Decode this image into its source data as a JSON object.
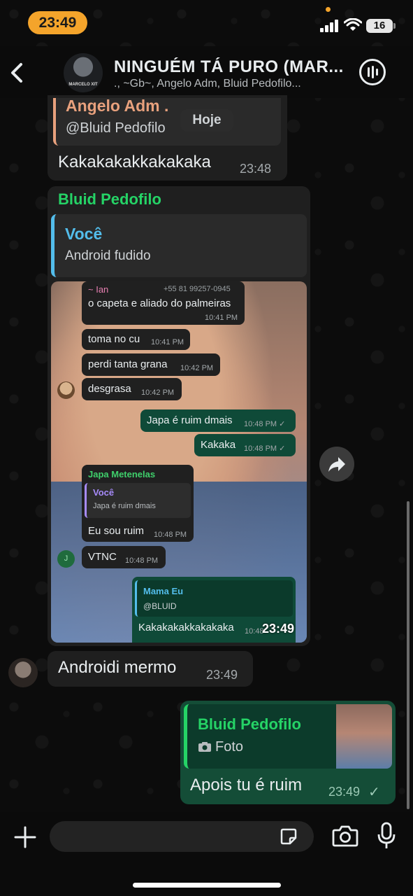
{
  "status_bar": {
    "time": "23:49",
    "battery": "16"
  },
  "header": {
    "title": "NINGUÉM TÁ PURO (MAR...",
    "subtitle": "., ~Gb~, Angelo Adm, Bluid Pedofilo...",
    "avatar_text": "MARCELO XIT"
  },
  "messages": {
    "top_quote": {
      "sender": "Angelo Adm .",
      "text": "@Bluid Pedofilo",
      "date_chip": "Hoje"
    },
    "msg1": {
      "text": "Kakakakakkakakaka",
      "time": "23:48"
    },
    "msg2": {
      "sender": "Bluid Pedofilo",
      "quote_sender": "Você",
      "quote_text": "Android fudido",
      "time": "23:49",
      "screenshot": {
        "m1_sender": "~ Ian",
        "m1_phone": "+55 81 99257-0945",
        "m1_text": "o capeta e aliado do palmeiras",
        "m1_time": "10:41 PM",
        "m2_text": "toma no cu",
        "m2_time": "10:41 PM",
        "m3_text": "perdi tanta grana",
        "m3_time": "10:42 PM",
        "m4_text": "desgrasa",
        "m4_time": "10:42 PM",
        "m5_text": "Japa é ruim dmais",
        "m5_time": "10:48 PM ✓",
        "m6_text": "Kakaka",
        "m6_time": "10:48 PM ✓",
        "m7_sender": "Japa Metenelas",
        "m7_quote_sender": "Você",
        "m7_quote_text": "Japa é ruim dmais",
        "m7_text": "Eu sou ruim",
        "m7_time": "10:48 PM",
        "m8_avatar": "J",
        "m8_text": "VTNC",
        "m8_time": "10:48 PM",
        "m9_quote_sender": "Mama Eu",
        "m9_quote_text": "@BLUID",
        "m9_text": "Kakakakakkakakaka",
        "m9_time": "10:48"
      }
    },
    "msg3": {
      "text": "Androidi mermo",
      "time": "23:49"
    },
    "msg4": {
      "quote_sender": "Bluid Pedofilo",
      "quote_text": "Foto",
      "text": "Apois tu é ruim",
      "time": "23:49",
      "status": "✓"
    }
  },
  "colors": {
    "accent_green": "#25d366",
    "outgoing_bubble": "#144d37",
    "incoming_bubble": "#1f1f1f",
    "angelo_name": "#e8a17d",
    "voce_name": "#53bdeb"
  }
}
